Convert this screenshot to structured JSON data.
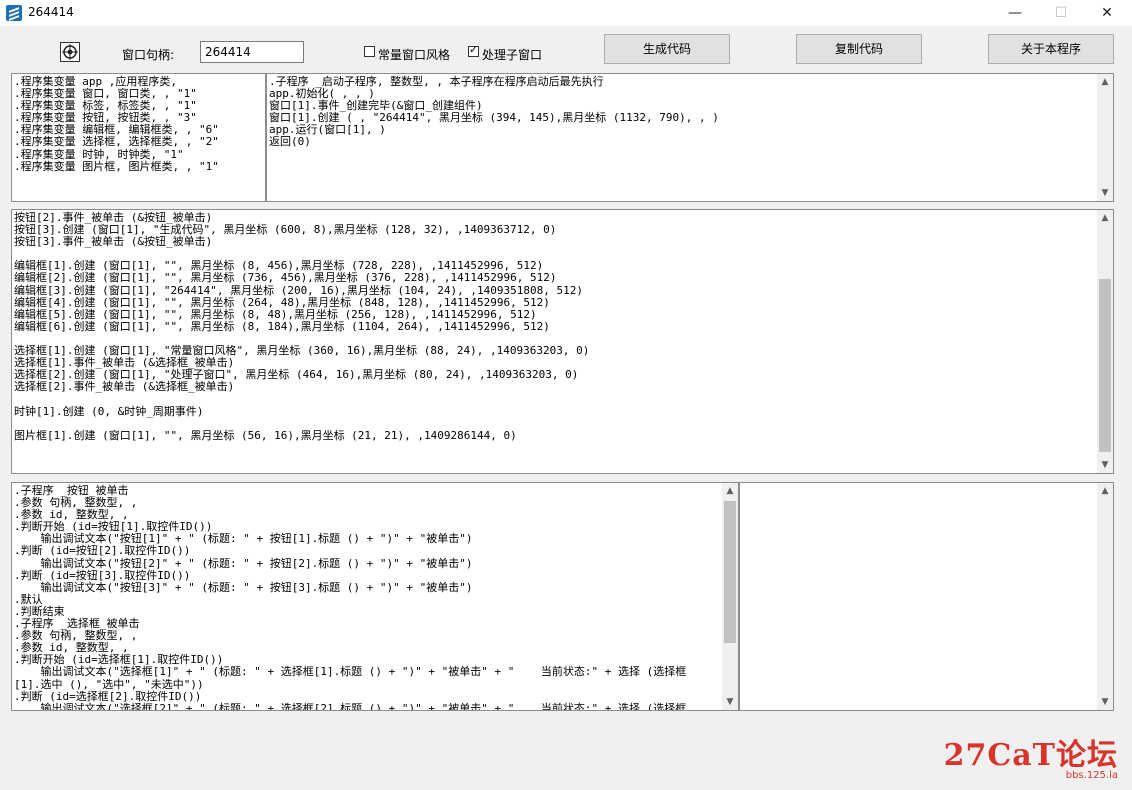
{
  "window": {
    "title": "264414",
    "controls": {
      "minimize": "—",
      "maximize": "☐",
      "close": "✕"
    }
  },
  "toolbar": {
    "handle_label": "窗口句柄:",
    "handle_value": "264414",
    "check1_label": "常量窗口风格",
    "check1_checked": false,
    "check2_label": "处理子窗口",
    "check2_checked": true,
    "btn_generate": "生成代码",
    "btn_copy": "复制代码",
    "btn_about": "关于本程序"
  },
  "panel_vars": {
    "text": ".程序集变量 app ,应用程序类,\n.程序集变量 窗口, 窗口类, , \"1\"\n.程序集变量 标签, 标签类, , \"1\"\n.程序集变量 按钮, 按钮类, , \"3\"\n.程序集变量 编辑框, 编辑框类, , \"6\"\n.程序集变量 选择框, 选择框类, , \"2\"\n.程序集变量 时钟, 时钟类, \"1\"\n.程序集变量 图片框, 图片框类, , \"1\""
  },
  "panel_main": {
    "text": ".子程序 _启动子程序, 整数型, , 本子程序在程序启动后最先执行\napp.初始化( , , )\n窗口[1].事件_创建完毕(&窗口_创建组件)\n窗口[1].创建 ( , \"264414\", 黑月坐标 (394, 145),黑月坐标 (1132, 790), , )\napp.运行(窗口[1], )\n返回(0)"
  },
  "panel_components": {
    "text": "按钮[2].事件_被单击 (&按钮_被单击)\n按钮[3].创建 (窗口[1], \"生成代码\", 黑月坐标 (600, 8),黑月坐标 (128, 32), ,1409363712, 0)\n按钮[3].事件_被单击 (&按钮_被单击)\n\n编辑框[1].创建 (窗口[1], \"\", 黑月坐标 (8, 456),黑月坐标 (728, 228), ,1411452996, 512)\n编辑框[2].创建 (窗口[1], \"\", 黑月坐标 (736, 456),黑月坐标 (376, 228), ,1411452996, 512)\n编辑框[3].创建 (窗口[1], \"264414\", 黑月坐标 (200, 16),黑月坐标 (104, 24), ,1409351808, 512)\n编辑框[4].创建 (窗口[1], \"\", 黑月坐标 (264, 48),黑月坐标 (848, 128), ,1411452996, 512)\n编辑框[5].创建 (窗口[1], \"\", 黑月坐标 (8, 48),黑月坐标 (256, 128), ,1411452996, 512)\n编辑框[6].创建 (窗口[1], \"\", 黑月坐标 (8, 184),黑月坐标 (1104, 264), ,1411452996, 512)\n\n选择框[1].创建 (窗口[1], \"常量窗口风格\", 黑月坐标 (360, 16),黑月坐标 (88, 24), ,1409363203, 0)\n选择框[1].事件_被单击 (&选择框_被单击)\n选择框[2].创建 (窗口[1], \"处理子窗口\", 黑月坐标 (464, 16),黑月坐标 (80, 24), ,1409363203, 0)\n选择框[2].事件_被单击 (&选择框_被单击)\n\n时钟[1].创建 (0, &时钟_周期事件)\n\n图片框[1].创建 (窗口[1], \"\", 黑月坐标 (56, 16),黑月坐标 (21, 21), ,1409286144, 0)"
  },
  "panel_events": {
    "text": ".子程序 _按钮_被单击\n.参数 句柄, 整数型, ,\n.参数 id, 整数型, ,\n.判断开始 (id=按钮[1].取控件ID())\n    输出调试文本(\"按钮[1]\" + \" (标题: \" + 按钮[1].标题 () + \")\" + \"被单击\")\n.判断 (id=按钮[2].取控件ID())\n    输出调试文本(\"按钮[2]\" + \" (标题: \" + 按钮[2].标题 () + \")\" + \"被单击\")\n.判断 (id=按钮[3].取控件ID())\n    输出调试文本(\"按钮[3]\" + \" (标题: \" + 按钮[3].标题 () + \")\" + \"被单击\")\n.默认\n.判断结束\n.子程序 _选择框_被单击\n.参数 句柄, 整数型, ,\n.参数 id, 整数型, ,\n.判断开始 (id=选择框[1].取控件ID())\n    输出调试文本(\"选择框[1]\" + \" (标题: \" + 选择框[1].标题 () + \")\" + \"被单击\" + \"    当前状态:\" + 选择 (选择框\n[1].选中 (), \"选中\", \"未选中\"))\n.判断 (id=选择框[2].取控件ID())\n    输出调试文本(\"选择框[2]\" + \" (标题: \" + 选择框[2].标题 () + \")\" + \"被单击\" + \"    当前状态:\" + 选择 (选择框"
  },
  "panel_output": {
    "text": ""
  },
  "watermark": {
    "main": "27CaT论坛",
    "sub": "bbs.125.la"
  }
}
